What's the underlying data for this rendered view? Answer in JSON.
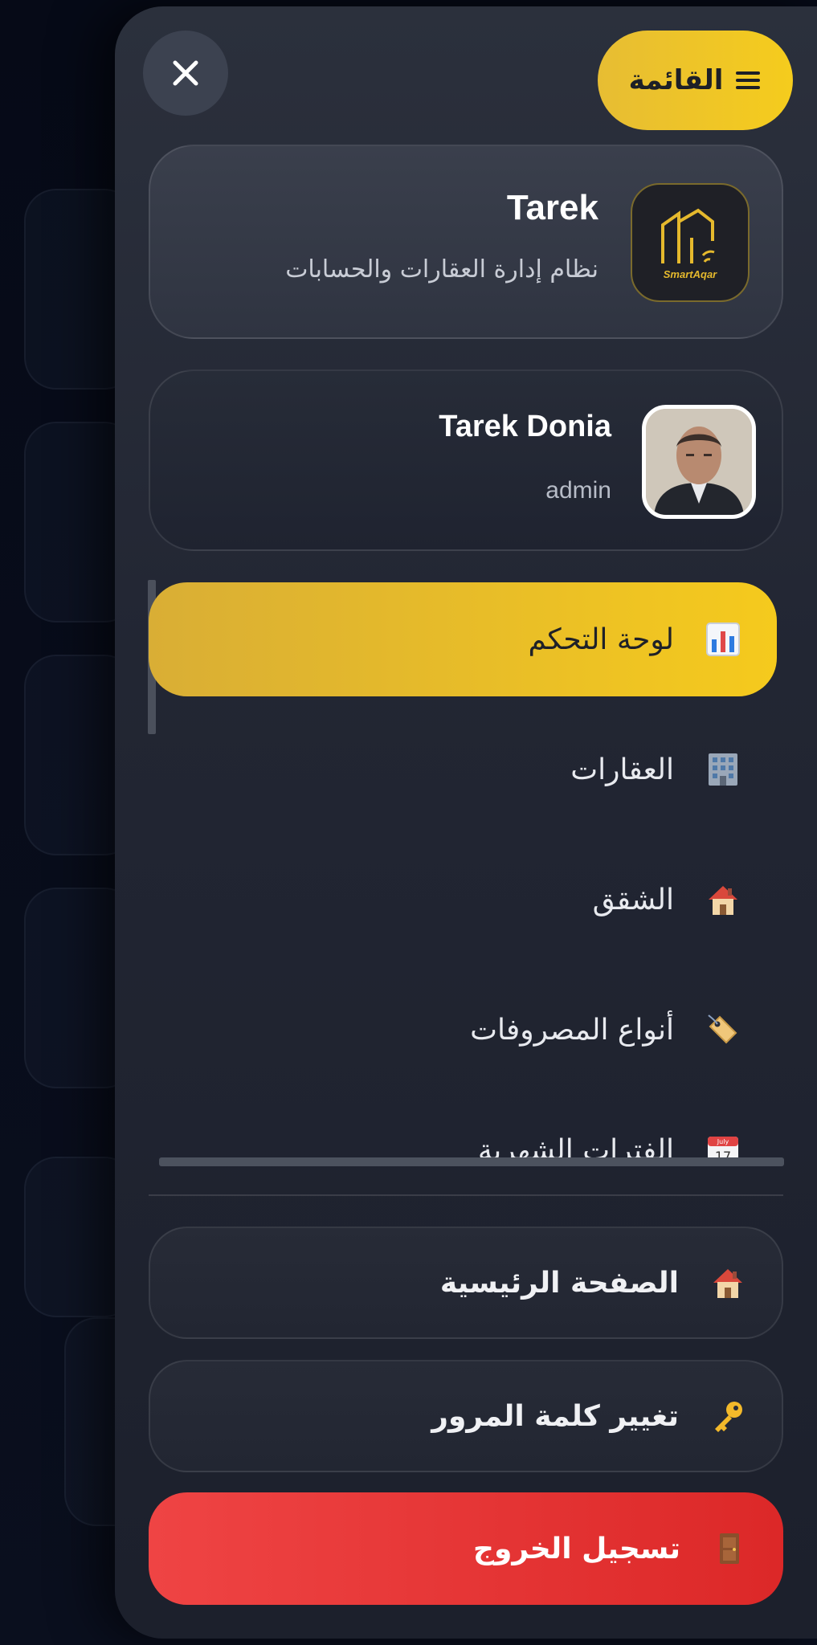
{
  "header": {
    "menu_label": "القائمة",
    "menu_icon": "hamburger-icon",
    "close_icon": "close-icon"
  },
  "brand": {
    "title": "Tarek",
    "subtitle": "نظام إدارة العقارات والحسابات",
    "logo_text": "SmartAqar",
    "accent": "#F5CC1D"
  },
  "user": {
    "name": "Tarek Donia",
    "role": "admin"
  },
  "nav": {
    "items": [
      {
        "label": "لوحة التحكم",
        "icon": "chart-icon",
        "active": true
      },
      {
        "label": "العقارات",
        "icon": "building-icon",
        "active": false
      },
      {
        "label": "الشقق",
        "icon": "house-icon",
        "active": false
      },
      {
        "label": "أنواع المصروفات",
        "icon": "tag-icon",
        "active": false
      },
      {
        "label": "الفترات الشهرية",
        "icon": "calendar-icon",
        "active": false
      }
    ],
    "calendar_month": "July",
    "calendar_day": "17"
  },
  "footer": {
    "home_label": "الصفحة الرئيسية",
    "password_label": "تغيير كلمة المرور",
    "logout_label": "تسجيل الخروج",
    "logout_color": "#E53535"
  }
}
